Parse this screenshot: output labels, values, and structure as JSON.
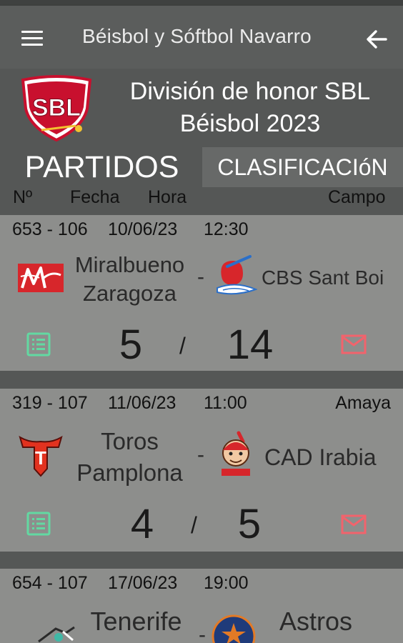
{
  "app": {
    "title": "Béisbol y Sóftbol Navarro"
  },
  "division": {
    "line1": "División de honor SBL",
    "line2": "Béisbol 2023",
    "logo_text": "SBL"
  },
  "tabs": {
    "partidos": "PARTIDOS",
    "clasificacion": "CLASIFICACIóN"
  },
  "columns": {
    "num": "Nº",
    "fecha": "Fecha",
    "hora": "Hora",
    "campo": "Campo"
  },
  "matches": [
    {
      "num": "653 - 106",
      "fecha": "10/06/23",
      "hora": "12:30",
      "campo": "",
      "home": {
        "name_l1": "Miralbueno",
        "name_l2": "Zaragoza"
      },
      "away": {
        "name_l1": "CBS Sant Boi",
        "name_l2": ""
      },
      "dash": "-",
      "home_score": "5",
      "sep": "/",
      "away_score": "14"
    },
    {
      "num": "319 - 107",
      "fecha": "11/06/23",
      "hora": "11:00",
      "campo": "Amaya",
      "home": {
        "name_l1": "Toros",
        "name_l2": "Pamplona",
        "logo_text": "T"
      },
      "away": {
        "name_l1": "CAD Irabia",
        "name_l2": ""
      },
      "dash": "-",
      "home_score": "4",
      "sep": "/",
      "away_score": "5"
    },
    {
      "num": "654 - 107",
      "fecha": "17/06/23",
      "hora": "19:00",
      "campo": "",
      "home": {
        "name_l1": "Tenerife"
      },
      "away": {
        "name_l1": "Astros"
      },
      "dash": "-"
    }
  ],
  "icons": {
    "menu": "menu-icon",
    "back": "arrow-back-icon",
    "list": "list-icon",
    "mail": "mail-icon"
  },
  "colors": {
    "appbar": "#5b5d5c",
    "background": "#555756",
    "card": "#8d8e8c",
    "tab_selected": "#676968",
    "list_icon": "#62d9a2",
    "mail_icon": "#f2636c",
    "logo_red": "#c8102e"
  }
}
